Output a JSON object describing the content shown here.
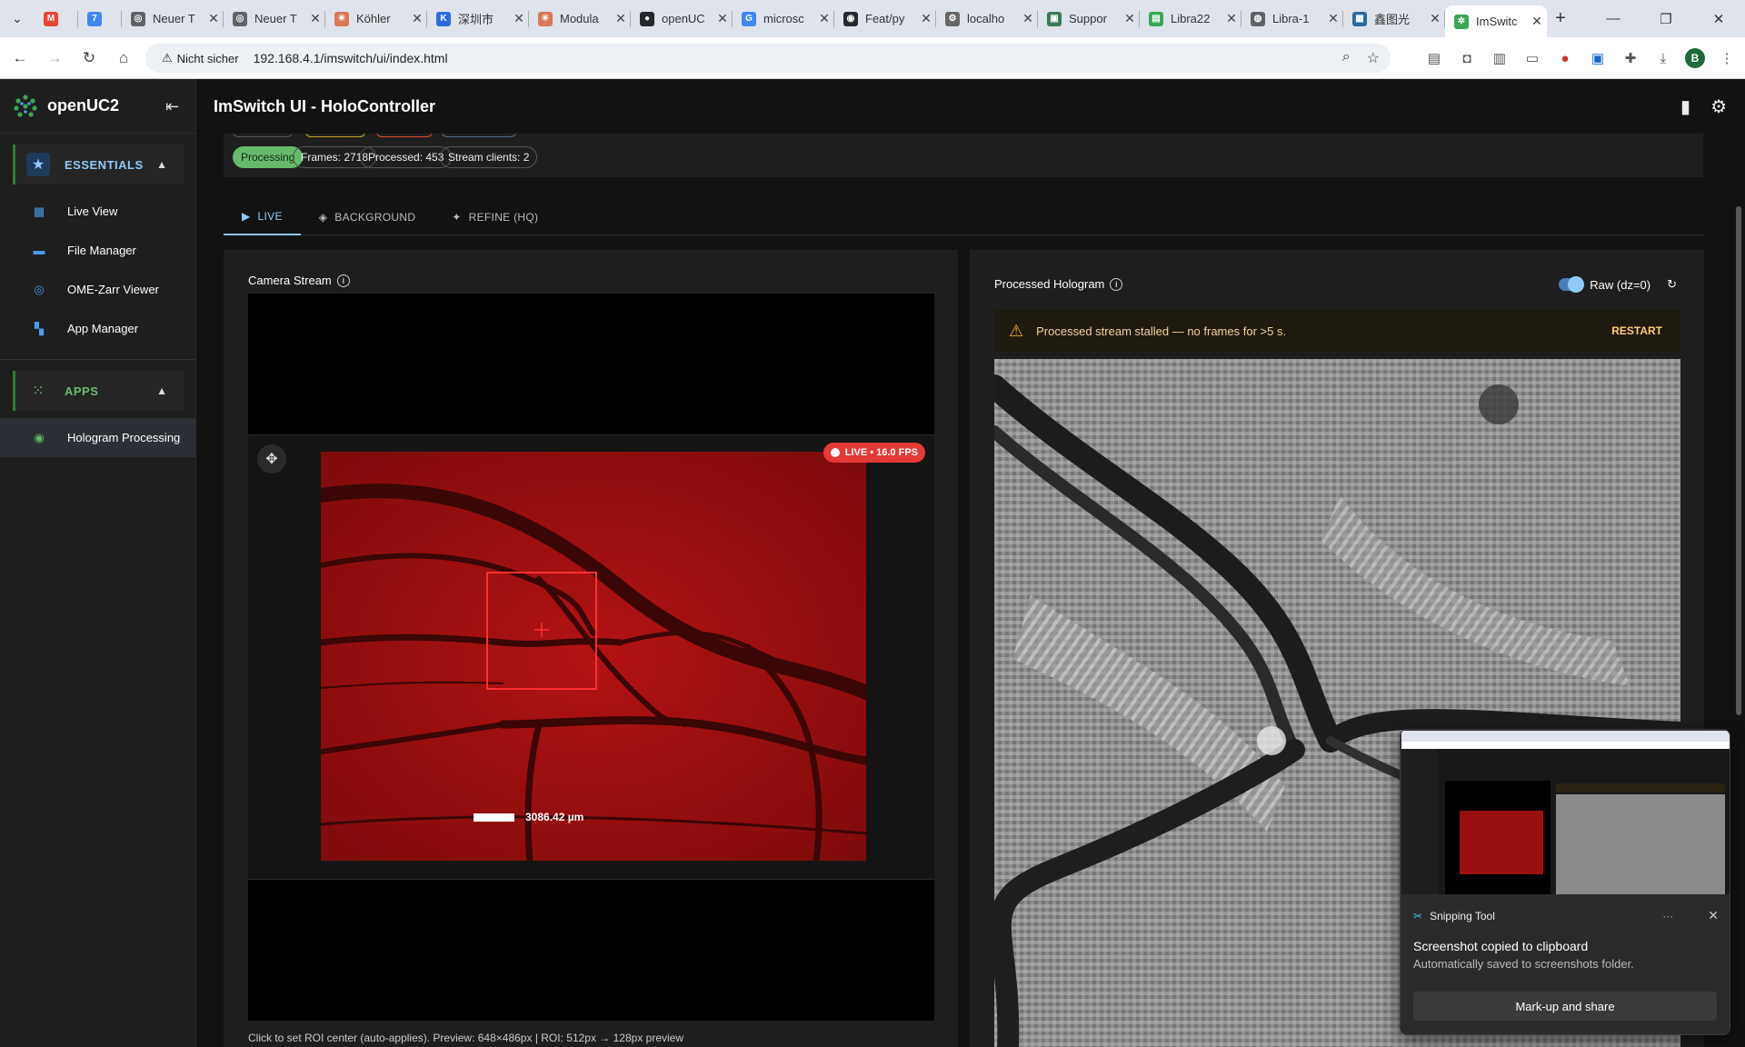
{
  "browser": {
    "tabs": [
      {
        "title": "",
        "color": "#ea4335",
        "icon": "gmail-icon",
        "glyph": "M"
      },
      {
        "title": "",
        "color": "#4285f4",
        "icon": "calendar-icon",
        "glyph": "7"
      },
      {
        "title": "Neuer T",
        "color": "#5f6368",
        "icon": "chrome-icon",
        "glyph": "◎"
      },
      {
        "title": "Neuer T",
        "color": "#5f6368",
        "icon": "chrome-icon",
        "glyph": "◎"
      },
      {
        "title": "Köhler",
        "color": "#d97757",
        "icon": "claude-icon",
        "glyph": "✳"
      },
      {
        "title": "深圳市",
        "color": "#2d6cdf",
        "icon": "k-icon",
        "glyph": "K"
      },
      {
        "title": "Modula",
        "color": "#d97757",
        "icon": "claude-icon",
        "glyph": "✳"
      },
      {
        "title": "openUC",
        "color": "#24292e",
        "icon": "github-icon",
        "glyph": "●"
      },
      {
        "title": "microsc",
        "color": "#4285f4",
        "icon": "google-icon",
        "glyph": "G"
      },
      {
        "title": "Feat/py",
        "color": "#24292e",
        "icon": "github-copilot-icon",
        "glyph": "◉"
      },
      {
        "title": "localho",
        "color": "#666666",
        "icon": "gear-icon",
        "glyph": "⚙"
      },
      {
        "title": "Suppor",
        "color": "#3b7a57",
        "icon": "support-icon",
        "glyph": "▣"
      },
      {
        "title": "Libra22",
        "color": "#3aa757",
        "icon": "libra-icon",
        "glyph": "▤"
      },
      {
        "title": "Libra-1",
        "color": "#5f6368",
        "icon": "globe-icon",
        "glyph": "◍"
      },
      {
        "title": "鑫图光",
        "color": "#2a6a9e",
        "icon": "site-icon",
        "glyph": "▦"
      },
      {
        "title": "ImSwitc",
        "color": "#3aa757",
        "icon": "openuc2-icon",
        "glyph": "✲",
        "active": true
      }
    ],
    "security_label": "Nicht sicher",
    "url": "192.168.4.1/imswitch/ui/index.html",
    "profile_initial": "B"
  },
  "sidebar": {
    "brand": "openUC2",
    "sections": [
      {
        "label": "ESSENTIALS",
        "icon": "star-icon"
      },
      {
        "label": "APPS",
        "icon": "grid-icon"
      }
    ],
    "essentials": [
      {
        "label": "Live View",
        "icon": "dashboard-icon"
      },
      {
        "label": "File Manager",
        "icon": "folder-icon"
      },
      {
        "label": "OME-Zarr Viewer",
        "icon": "viewer-icon"
      },
      {
        "label": "App Manager",
        "icon": "apps-icon"
      }
    ],
    "apps": [
      {
        "label": "Hologram Processing",
        "icon": "eye-icon",
        "active": true
      }
    ]
  },
  "header": {
    "title": "ImSwitch UI - HoloController"
  },
  "status": {
    "processing": "Processing",
    "frames": "Frames: 2718",
    "processed": "Processed: 453",
    "stream_clients": "Stream clients: 2"
  },
  "tabs": [
    {
      "label": "LIVE",
      "icon": "play-icon",
      "active": true
    },
    {
      "label": "BACKGROUND",
      "icon": "layers-icon"
    },
    {
      "label": "REFINE (HQ)",
      "icon": "sparkle-icon"
    }
  ],
  "camera_panel": {
    "title": "Camera Stream",
    "live_badge": "LIVE • 16.0 FPS",
    "scale_label": "3086.42 µm",
    "caption": "Click to set ROI center (auto-applies). Preview: 648×486px | ROI: 512px → 128px preview"
  },
  "holo_panel": {
    "title": "Processed Hologram",
    "raw_label": "Raw (dz=0)",
    "raw_enabled": true,
    "alert": "Processed stream stalled — no frames for >5 s.",
    "restart_label": "RESTART"
  },
  "toast": {
    "app": "Snipping Tool",
    "title": "Screenshot copied to clipboard",
    "subtitle": "Automatically saved to screenshots folder.",
    "button": "Mark-up and share"
  },
  "colors": {
    "accent": "#90caf9",
    "green": "#66bb6a",
    "live_red": "#e53935",
    "warning": "#ffa726"
  }
}
